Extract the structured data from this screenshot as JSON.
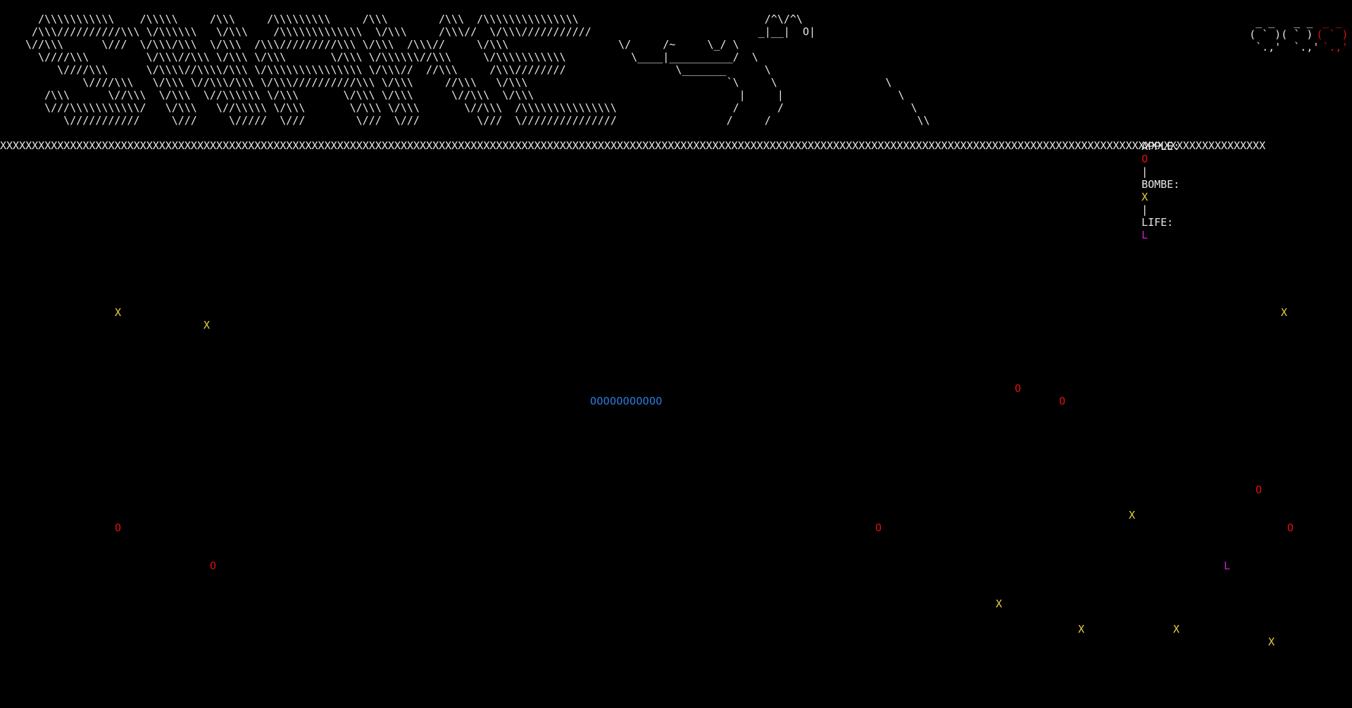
{
  "title_art": "  /\\\\\\\\\\\\\\\\\\\\\\    /\\\\\\\\\\     /\\\\\\     /\\\\\\\\\\\\\\\\\\     /\\\\\\        /\\\\\\  /\\\\\\\\\\\\\\\\\\\\\\\\\\\\\\\n /\\\\\\//////////\\\\\\ \\/\\\\\\\\\\\\   \\/\\\\\\    /\\\\\\\\\\\\\\\\\\\\\\\\\\  \\/\\\\\\     /\\\\\\//  \\/\\\\\\///////////\n\\//\\\\\\      \\///  \\/\\\\\\/\\\\\\  \\/\\\\\\  /\\\\\\/////////\\\\\\ \\/\\\\\\  /\\\\\\//     \\/\\\\\\\n  \\////\\\\\\         \\/\\\\\\//\\\\\\ \\/\\\\\\ \\/\\\\\\       \\/\\\\\\ \\/\\\\\\\\\\\\//\\\\\\     \\/\\\\\\\\\\\\\\\\\\\\\\\n     \\////\\\\\\      \\/\\\\\\\\//\\\\\\\\/\\\\\\ \\/\\\\\\\\\\\\\\\\\\\\\\\\\\\\\\ \\/\\\\\\//  //\\\\\\     /\\\\\\////////\n         \\////\\\\\\   \\/\\\\\\ \\//\\\\\\/\\\\\\ \\/\\\\\\//////////\\\\\\ \\/\\\\\\     //\\\\\\   \\/\\\\\\\n   /\\\\\\      \\//\\\\\\  \\/\\\\\\  \\//\\\\\\\\\\\\ \\/\\\\\\       \\/\\\\\\ \\/\\\\\\      \\//\\\\\\  \\/\\\\\\\n   \\///\\\\\\\\\\\\\\\\\\\\\\/   \\/\\\\\\   \\//\\\\\\\\\\ \\/\\\\\\       \\/\\\\\\ \\/\\\\\\       \\//\\\\\\  /\\\\\\\\\\\\\\\\\\\\\\\\\\\\\\\n      \\///////////     \\///     \\/////  \\///        \\///  \\///         \\///  \\///////////////",
  "helicopter_art": "                         /^\\/^\\\n                        _|__|  O|\n  \\/     /~     \\_/ \\\n    \\____|__________/  \\\n           \\_______      \\\n                   `\\     \\                 \\\n                     |     |                  \\\n                    /      /                    \\\n                   /     /                       \\\\",
  "hearts": {
    "white_art": " _ _   _ _\n( ` )( ` )\n `.,'  `.,'",
    "red_art": " _ _\n( ` )\n `.,'"
  },
  "legend": {
    "apple_label": "APPLE:",
    "apple_symbol": "O",
    "sep1": "|",
    "bomb_label": "BOMBE:",
    "bomb_symbol": "X",
    "sep2": "|",
    "life_label": "LIFE:",
    "life_symbol": "L"
  },
  "border_line": "XXXXXXXXXXXXXXXXXXXXXXXXXXXXXXXXXXXXXXXXXXXXXXXXXXXXXXXXXXXXXXXXXXXXXXXXXXXXXXXXXXXXXXXXXXXXXXXXXXXXXXXXXXXXXXXXXXXXXXXXXXXXXXXXXXXXXXXXXXXXXXXXXXXXXXXXXXXXXXXXXXXXXXXXXXXXXXXXXXXXXXXXXXXXXXXXXXXXXXX",
  "snake": "OOOOOOOOOOO",
  "colors": {
    "apple": "#d11111",
    "bomb": "#e8d040",
    "life": "#d020d0",
    "snake": "#2a7be0",
    "background": "#000000"
  },
  "items": [
    {
      "type": "bomb",
      "symbol": "X"
    },
    {
      "type": "bomb",
      "symbol": "X"
    },
    {
      "type": "bomb",
      "symbol": "X"
    },
    {
      "type": "apple",
      "symbol": "O"
    },
    {
      "type": "apple",
      "symbol": "O"
    },
    {
      "type": "apple",
      "symbol": "O"
    },
    {
      "type": "bomb",
      "symbol": "X"
    },
    {
      "type": "apple",
      "symbol": "O"
    },
    {
      "type": "apple",
      "symbol": "O"
    },
    {
      "type": "apple",
      "symbol": "O"
    },
    {
      "type": "life",
      "symbol": "L"
    },
    {
      "type": "apple",
      "symbol": "O"
    },
    {
      "type": "bomb",
      "symbol": "X"
    },
    {
      "type": "bomb",
      "symbol": "X"
    },
    {
      "type": "bomb",
      "symbol": "X"
    },
    {
      "type": "bomb",
      "symbol": "X"
    }
  ]
}
